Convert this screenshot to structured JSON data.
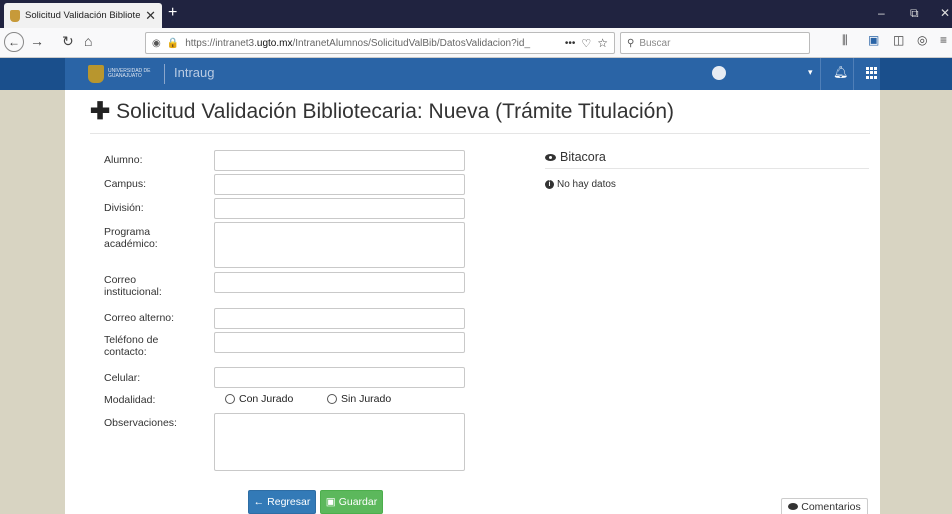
{
  "browser": {
    "tab_title": "Solicitud Validación Bibliotecar",
    "tab_close": "✕",
    "new_tab": "+",
    "window_controls": [
      "–",
      "⧉",
      "✕"
    ],
    "url_prefix": "https://intranet3.",
    "url_host": "ugto.mx",
    "url_path": "/IntranetAlumnos/SolicitudValBib/DatosValidacion?id_",
    "url_more": "•••",
    "search_placeholder": "Buscar"
  },
  "app": {
    "logo_text": "UNIVERSIDAD DE GUANAJUATO",
    "name": "Intraug",
    "user_caret": "▾"
  },
  "page": {
    "title": "Solicitud Validación Bibliotecaria: Nueva (Trámite Titulación)"
  },
  "form": {
    "fields": [
      {
        "label": "Alumno:",
        "value": ""
      },
      {
        "label": "Campus:",
        "value": ""
      },
      {
        "label": "División:",
        "value": ""
      },
      {
        "label": "Programa académico:",
        "value": ""
      },
      {
        "label": "Correo institucional:",
        "value": ""
      },
      {
        "label": "Correo alterno:",
        "value": ""
      },
      {
        "label": "Teléfono de contacto:",
        "value": ""
      },
      {
        "label": "Celular:",
        "value": ""
      },
      {
        "label": "Modalidad:",
        "value": ""
      },
      {
        "label": "Observaciones:",
        "value": ""
      }
    ],
    "modalidad_options": [
      "Con Jurado",
      "Sin Jurado"
    ],
    "back_button": "Regresar",
    "save_button": "Guardar"
  },
  "bitacora": {
    "title": "Bitacora",
    "empty_message": "No hay datos"
  },
  "comments_button": "Comentarios"
}
